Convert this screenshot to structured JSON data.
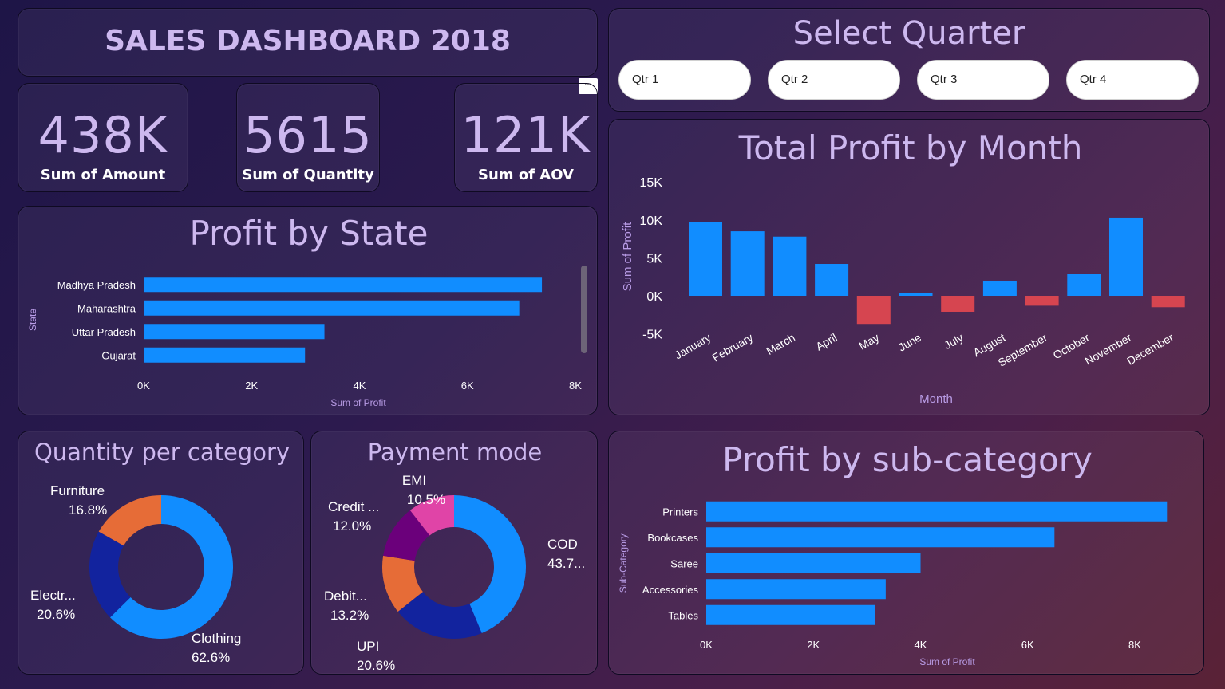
{
  "title": "SALES DASHBOARD 2018",
  "kpis": [
    {
      "value": "438K",
      "label": "Sum of Amount"
    },
    {
      "value": "5615",
      "label": "Sum of Quantity"
    },
    {
      "value": "121K",
      "label": "Sum of AOV"
    }
  ],
  "quarter_slicer": {
    "title": "Select Quarter",
    "options": [
      "Qtr 1",
      "Qtr 2",
      "Qtr 3",
      "Qtr 4"
    ]
  },
  "colors": {
    "positive": "#118dff",
    "negative": "#d64550",
    "title": "#cdb8ef"
  },
  "chart_data": [
    {
      "type": "bar",
      "orientation": "horizontal",
      "title": "Profit by State",
      "xlabel": "Sum of Profit",
      "ylabel": "State",
      "categories": [
        "Madhya Pradesh",
        "Maharashtra",
        "Uttar Pradesh",
        "Gujarat"
      ],
      "values": [
        7380,
        6960,
        3350,
        2990
      ],
      "xlim": [
        0,
        8000
      ],
      "ticks": [
        "0K",
        "2K",
        "4K",
        "6K",
        "8K"
      ]
    },
    {
      "type": "bar",
      "title": "Total Profit by Month",
      "xlabel": "Month",
      "ylabel": "Sum of Profit",
      "categories": [
        "January",
        "February",
        "March",
        "April",
        "May",
        "June",
        "July",
        "August",
        "September",
        "October",
        "November",
        "December"
      ],
      "values": [
        9700,
        8500,
        7800,
        4200,
        -3700,
        400,
        -2100,
        2000,
        -1300,
        2900,
        10300,
        -1500
      ],
      "ylim": [
        -5000,
        15000
      ],
      "ticks": [
        "-5K",
        "0K",
        "5K",
        "10K",
        "15K"
      ]
    },
    {
      "type": "pie",
      "donut": true,
      "title": "Quantity per category",
      "slices": [
        {
          "label": "Clothing",
          "pct_label": "62.6%",
          "value": 62.6,
          "color": "#118dff"
        },
        {
          "label": "Electr...",
          "pct_label": "20.6%",
          "value": 20.6,
          "color": "#12239e"
        },
        {
          "label": "Furniture",
          "pct_label": "16.8%",
          "value": 16.8,
          "color": "#e66c37"
        }
      ]
    },
    {
      "type": "pie",
      "donut": true,
      "title": "Payment mode",
      "slices": [
        {
          "label": "COD",
          "pct_label": "43.7...",
          "value": 43.7,
          "color": "#118dff"
        },
        {
          "label": "UPI",
          "pct_label": "20.6%",
          "value": 20.6,
          "color": "#12239e"
        },
        {
          "label": "Debit...",
          "pct_label": "13.2%",
          "value": 13.2,
          "color": "#e66c37"
        },
        {
          "label": "Credit ...",
          "pct_label": "12.0%",
          "value": 12.0,
          "color": "#6b007b"
        },
        {
          "label": "EMI",
          "pct_label": "10.5%",
          "value": 10.5,
          "color": "#e044a7"
        }
      ]
    },
    {
      "type": "bar",
      "orientation": "horizontal",
      "title": "Profit by sub-category",
      "xlabel": "Sum of Profit",
      "ylabel": "Sub-Category",
      "categories": [
        "Printers",
        "Bookcases",
        "Saree",
        "Accessories",
        "Tables"
      ],
      "values": [
        8600,
        6500,
        4000,
        3350,
        3150
      ],
      "xlim": [
        0,
        9000
      ],
      "ticks": [
        "0K",
        "2K",
        "4K",
        "6K",
        "8K"
      ]
    }
  ]
}
